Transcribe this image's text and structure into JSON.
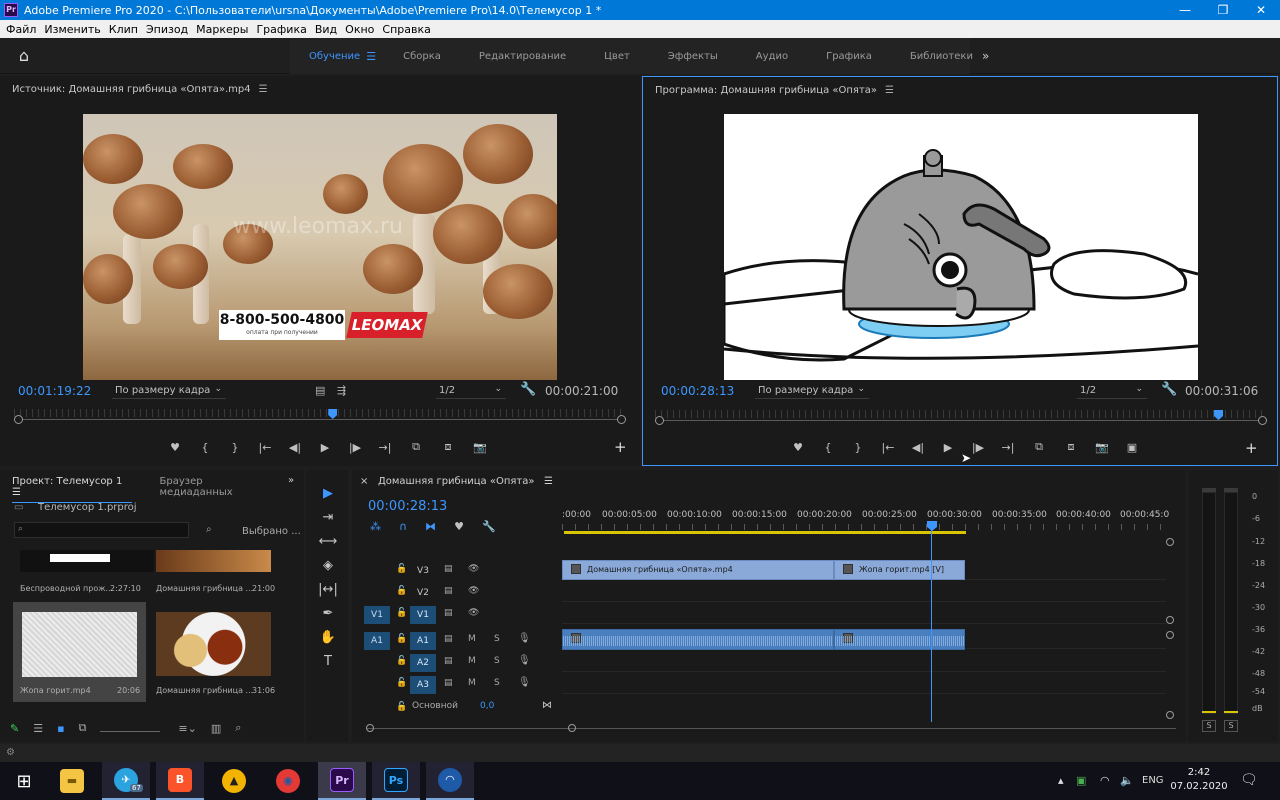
{
  "window": {
    "app_icon": "Pr",
    "title": "Adobe Premiere Pro 2020 - C:\\Пользователи\\ursna\\Документы\\Adobe\\Premiere Pro\\14.0\\Телемусор 1 *",
    "minimize": "—",
    "maximize": "❐",
    "close": "✕"
  },
  "menu": [
    "Файл",
    "Изменить",
    "Клип",
    "Эпизод",
    "Маркеры",
    "Графика",
    "Вид",
    "Окно",
    "Справка"
  ],
  "workspaces": {
    "items": [
      "Обучение",
      "Сборка",
      "Редактирование",
      "Цвет",
      "Эффекты",
      "Аудио",
      "Графика",
      "Библиотеки"
    ],
    "active": "Обучение",
    "menu_glyph": "☰",
    "overflow_glyph": "»",
    "home_glyph": "⌂"
  },
  "source": {
    "title": "Источник: Домашняя грибница «Опята».mp4",
    "menu_glyph": "☰",
    "timecode": "00:01:19:22",
    "fit": "По размеру кадра",
    "resolution": "1/2",
    "duration": "00:00:21:00",
    "watermark": "www.leomax.ru",
    "phone": "8-800-500-4800",
    "phone_sub": "оплата при получении",
    "brand": "LEOMAX",
    "transport": [
      "♥",
      "{",
      "}",
      "|←",
      "◀|",
      "▶",
      "|▶",
      "→|",
      "⧉",
      "⧈",
      "📷"
    ],
    "plus": "+",
    "playhead_percent": 52
  },
  "program": {
    "title": "Программа: Домашняя грибница «Опята»",
    "menu_glyph": "☰",
    "timecode": "00:00:28:13",
    "fit": "По размеру кадра",
    "resolution": "1/2",
    "duration": "00:00:31:06",
    "transport": [
      "♥",
      "{",
      "}",
      "|←",
      "◀|",
      "▶",
      "|▶",
      "→|",
      "⧉",
      "⧈",
      "📷",
      "▣"
    ],
    "plus": "+",
    "playhead_percent": 92
  },
  "project": {
    "tabs": [
      "Проект: Телемусор 1",
      "Браузер медиаданных"
    ],
    "menu_glyph": "☰",
    "overflow_glyph": "»",
    "file": "Телемусор 1.prproj",
    "selected_label": "Выбрано ...",
    "items": [
      {
        "name": "Беспроводной прож...",
        "duration": "2:27:10"
      },
      {
        "name": "Домашняя грибница ...",
        "duration": "21:00"
      },
      {
        "name": "Жопа горит.mp4",
        "duration": "20:06"
      },
      {
        "name": "Домашняя грибница ...",
        "duration": "31:06"
      }
    ]
  },
  "tools": [
    "▶",
    "⇥",
    "⟷",
    "◈",
    "|↔|",
    "✒",
    "✋",
    "T"
  ],
  "timeline": {
    "title": "Домашняя грибница «Опята»",
    "close_glyph": "×",
    "menu_glyph": "☰",
    "timecode": "00:00:28:13",
    "ruler": [
      ":00:00",
      "00:00:05:00",
      "00:00:10:00",
      "00:00:15:00",
      "00:00:20:00",
      "00:00:25:00",
      "00:00:30:00",
      "00:00:35:00",
      "00:00:40:00",
      "00:00:45:0"
    ],
    "video_tracks": [
      {
        "target": "",
        "name": "V3",
        "enabled": false
      },
      {
        "target": "",
        "name": "V2",
        "enabled": false
      },
      {
        "target": "V1",
        "name": "V1",
        "enabled": true
      }
    ],
    "audio_tracks": [
      {
        "target": "A1",
        "name": "A1"
      },
      {
        "target": "",
        "name": "A2"
      },
      {
        "target": "",
        "name": "A3"
      }
    ],
    "audio_buttons": {
      "mute": "M",
      "solo": "S"
    },
    "clips_v": [
      {
        "label": "Домашняя грибница «Опята».mp4"
      },
      {
        "label": "Жопа горит.mp4 [V]"
      }
    ],
    "master": {
      "label": "Основной",
      "value": "0,0"
    }
  },
  "meter": {
    "scale": [
      "0",
      "-6",
      "-12",
      "-18",
      "-24",
      "-30",
      "-36",
      "-42",
      "-48",
      "-54",
      "dB"
    ],
    "solo": "S"
  },
  "taskbar": {
    "telegram_badge": "67",
    "lang": "ENG",
    "time": "2:42",
    "date": "07.02.2020",
    "apps": [
      {
        "name": "explorer",
        "glyph": "📁",
        "color": "#f4c542"
      },
      {
        "name": "telegram",
        "glyph": "✈",
        "color": "#2aa3df"
      },
      {
        "name": "brave",
        "glyph": "🦁",
        "color": "#fb542b"
      },
      {
        "name": "arduino",
        "glyph": "▲",
        "color": "#f2b400"
      },
      {
        "name": "app-red",
        "glyph": "◉",
        "color": "#e53935"
      },
      {
        "name": "premiere",
        "glyph": "Pr",
        "color": "#2a0a4a"
      },
      {
        "name": "photoshop",
        "glyph": "Ps",
        "color": "#001e36"
      },
      {
        "name": "app-blue",
        "glyph": "◠",
        "color": "#1e5aa8"
      }
    ]
  }
}
